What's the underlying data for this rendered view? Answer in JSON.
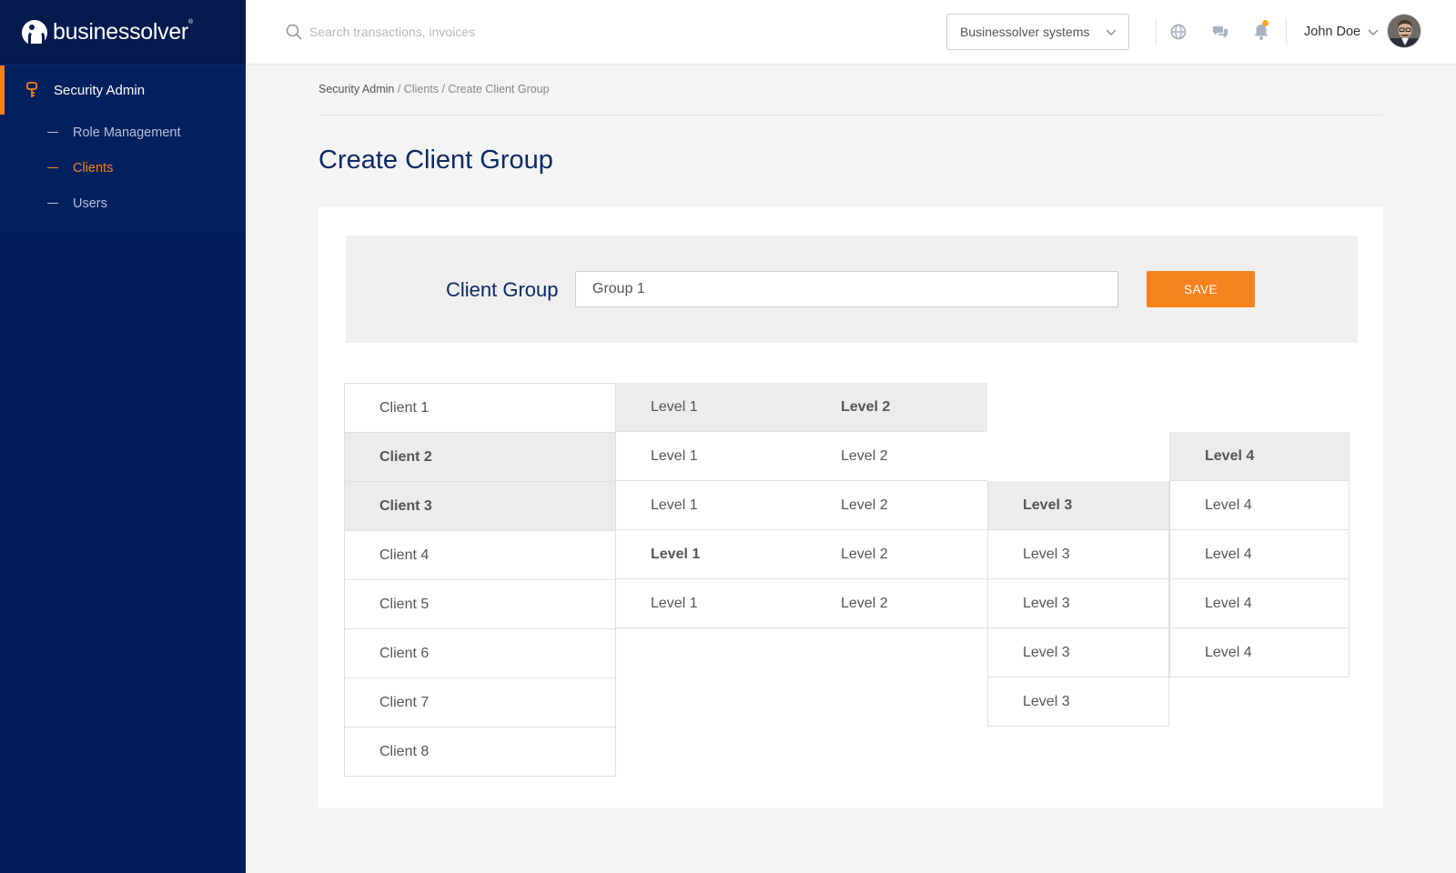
{
  "brand": {
    "name": "businessolver",
    "mark": "®"
  },
  "sidebar": {
    "section": "Security Admin",
    "items": [
      {
        "label": "Role Management",
        "active": false
      },
      {
        "label": "Clients",
        "active": true
      },
      {
        "label": "Users",
        "active": false
      }
    ]
  },
  "topbar": {
    "search_placeholder": "Search transactions, invoices",
    "system_select": "Businessolver systems",
    "user_name": "John Doe",
    "icons": [
      "globe-icon",
      "chat-icon",
      "bell-icon"
    ]
  },
  "breadcrumb": {
    "root": "Security Admin",
    "rest": " / Clients / Create Client Group"
  },
  "page": {
    "title": "Create Client Group"
  },
  "form": {
    "label": "Client Group",
    "value": "Group 1",
    "save_label": "SAVE"
  },
  "clients": [
    "Client 1",
    "Client 2",
    "Client 3",
    "Client 4",
    "Client 5",
    "Client 6",
    "Client 7",
    "Client 8"
  ],
  "level1": [
    "Level 1",
    "Level 1",
    "Level 1",
    "Level 1",
    "Level 1"
  ],
  "level2": [
    "Level 2",
    "Level 2",
    "Level 2",
    "Level 2",
    "Level 2"
  ],
  "level3": [
    "Level 3",
    "Level 3",
    "Level 3",
    "Level 3",
    "Level 3"
  ],
  "level4": [
    "Level 4",
    "Level 4",
    "Level 4",
    "Level 4",
    "Level 4"
  ],
  "colors": {
    "navy": "#041e5a",
    "accent": "#f5821f",
    "title": "#0b2a66"
  }
}
